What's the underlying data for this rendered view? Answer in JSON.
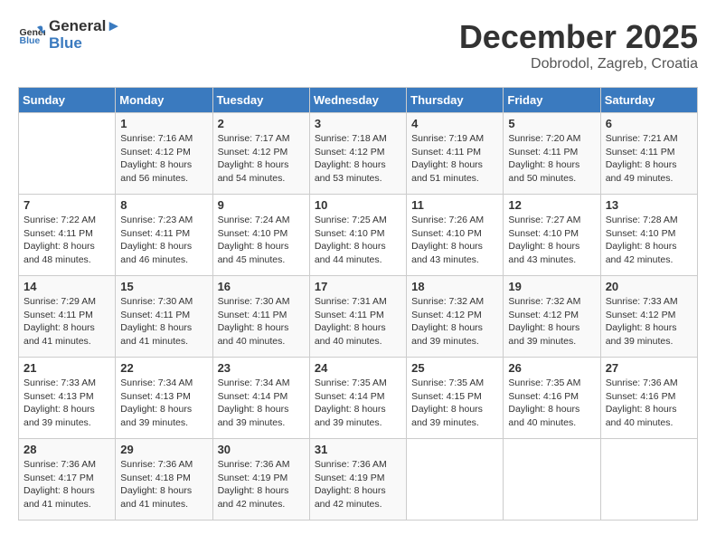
{
  "header": {
    "logo_general": "General",
    "logo_blue": "Blue",
    "month_year": "December 2025",
    "location": "Dobrodol, Zagreb, Croatia"
  },
  "weekdays": [
    "Sunday",
    "Monday",
    "Tuesday",
    "Wednesday",
    "Thursday",
    "Friday",
    "Saturday"
  ],
  "weeks": [
    [
      {
        "day": "",
        "sunrise": "",
        "sunset": "",
        "daylight": ""
      },
      {
        "day": "1",
        "sunrise": "Sunrise: 7:16 AM",
        "sunset": "Sunset: 4:12 PM",
        "daylight": "Daylight: 8 hours and 56 minutes."
      },
      {
        "day": "2",
        "sunrise": "Sunrise: 7:17 AM",
        "sunset": "Sunset: 4:12 PM",
        "daylight": "Daylight: 8 hours and 54 minutes."
      },
      {
        "day": "3",
        "sunrise": "Sunrise: 7:18 AM",
        "sunset": "Sunset: 4:12 PM",
        "daylight": "Daylight: 8 hours and 53 minutes."
      },
      {
        "day": "4",
        "sunrise": "Sunrise: 7:19 AM",
        "sunset": "Sunset: 4:11 PM",
        "daylight": "Daylight: 8 hours and 51 minutes."
      },
      {
        "day": "5",
        "sunrise": "Sunrise: 7:20 AM",
        "sunset": "Sunset: 4:11 PM",
        "daylight": "Daylight: 8 hours and 50 minutes."
      },
      {
        "day": "6",
        "sunrise": "Sunrise: 7:21 AM",
        "sunset": "Sunset: 4:11 PM",
        "daylight": "Daylight: 8 hours and 49 minutes."
      }
    ],
    [
      {
        "day": "7",
        "sunrise": "Sunrise: 7:22 AM",
        "sunset": "Sunset: 4:11 PM",
        "daylight": "Daylight: 8 hours and 48 minutes."
      },
      {
        "day": "8",
        "sunrise": "Sunrise: 7:23 AM",
        "sunset": "Sunset: 4:11 PM",
        "daylight": "Daylight: 8 hours and 46 minutes."
      },
      {
        "day": "9",
        "sunrise": "Sunrise: 7:24 AM",
        "sunset": "Sunset: 4:10 PM",
        "daylight": "Daylight: 8 hours and 45 minutes."
      },
      {
        "day": "10",
        "sunrise": "Sunrise: 7:25 AM",
        "sunset": "Sunset: 4:10 PM",
        "daylight": "Daylight: 8 hours and 44 minutes."
      },
      {
        "day": "11",
        "sunrise": "Sunrise: 7:26 AM",
        "sunset": "Sunset: 4:10 PM",
        "daylight": "Daylight: 8 hours and 43 minutes."
      },
      {
        "day": "12",
        "sunrise": "Sunrise: 7:27 AM",
        "sunset": "Sunset: 4:10 PM",
        "daylight": "Daylight: 8 hours and 43 minutes."
      },
      {
        "day": "13",
        "sunrise": "Sunrise: 7:28 AM",
        "sunset": "Sunset: 4:10 PM",
        "daylight": "Daylight: 8 hours and 42 minutes."
      }
    ],
    [
      {
        "day": "14",
        "sunrise": "Sunrise: 7:29 AM",
        "sunset": "Sunset: 4:11 PM",
        "daylight": "Daylight: 8 hours and 41 minutes."
      },
      {
        "day": "15",
        "sunrise": "Sunrise: 7:30 AM",
        "sunset": "Sunset: 4:11 PM",
        "daylight": "Daylight: 8 hours and 41 minutes."
      },
      {
        "day": "16",
        "sunrise": "Sunrise: 7:30 AM",
        "sunset": "Sunset: 4:11 PM",
        "daylight": "Daylight: 8 hours and 40 minutes."
      },
      {
        "day": "17",
        "sunrise": "Sunrise: 7:31 AM",
        "sunset": "Sunset: 4:11 PM",
        "daylight": "Daylight: 8 hours and 40 minutes."
      },
      {
        "day": "18",
        "sunrise": "Sunrise: 7:32 AM",
        "sunset": "Sunset: 4:12 PM",
        "daylight": "Daylight: 8 hours and 39 minutes."
      },
      {
        "day": "19",
        "sunrise": "Sunrise: 7:32 AM",
        "sunset": "Sunset: 4:12 PM",
        "daylight": "Daylight: 8 hours and 39 minutes."
      },
      {
        "day": "20",
        "sunrise": "Sunrise: 7:33 AM",
        "sunset": "Sunset: 4:12 PM",
        "daylight": "Daylight: 8 hours and 39 minutes."
      }
    ],
    [
      {
        "day": "21",
        "sunrise": "Sunrise: 7:33 AM",
        "sunset": "Sunset: 4:13 PM",
        "daylight": "Daylight: 8 hours and 39 minutes."
      },
      {
        "day": "22",
        "sunrise": "Sunrise: 7:34 AM",
        "sunset": "Sunset: 4:13 PM",
        "daylight": "Daylight: 8 hours and 39 minutes."
      },
      {
        "day": "23",
        "sunrise": "Sunrise: 7:34 AM",
        "sunset": "Sunset: 4:14 PM",
        "daylight": "Daylight: 8 hours and 39 minutes."
      },
      {
        "day": "24",
        "sunrise": "Sunrise: 7:35 AM",
        "sunset": "Sunset: 4:14 PM",
        "daylight": "Daylight: 8 hours and 39 minutes."
      },
      {
        "day": "25",
        "sunrise": "Sunrise: 7:35 AM",
        "sunset": "Sunset: 4:15 PM",
        "daylight": "Daylight: 8 hours and 39 minutes."
      },
      {
        "day": "26",
        "sunrise": "Sunrise: 7:35 AM",
        "sunset": "Sunset: 4:16 PM",
        "daylight": "Daylight: 8 hours and 40 minutes."
      },
      {
        "day": "27",
        "sunrise": "Sunrise: 7:36 AM",
        "sunset": "Sunset: 4:16 PM",
        "daylight": "Daylight: 8 hours and 40 minutes."
      }
    ],
    [
      {
        "day": "28",
        "sunrise": "Sunrise: 7:36 AM",
        "sunset": "Sunset: 4:17 PM",
        "daylight": "Daylight: 8 hours and 41 minutes."
      },
      {
        "day": "29",
        "sunrise": "Sunrise: 7:36 AM",
        "sunset": "Sunset: 4:18 PM",
        "daylight": "Daylight: 8 hours and 41 minutes."
      },
      {
        "day": "30",
        "sunrise": "Sunrise: 7:36 AM",
        "sunset": "Sunset: 4:19 PM",
        "daylight": "Daylight: 8 hours and 42 minutes."
      },
      {
        "day": "31",
        "sunrise": "Sunrise: 7:36 AM",
        "sunset": "Sunset: 4:19 PM",
        "daylight": "Daylight: 8 hours and 42 minutes."
      },
      {
        "day": "",
        "sunrise": "",
        "sunset": "",
        "daylight": ""
      },
      {
        "day": "",
        "sunrise": "",
        "sunset": "",
        "daylight": ""
      },
      {
        "day": "",
        "sunrise": "",
        "sunset": "",
        "daylight": ""
      }
    ]
  ]
}
